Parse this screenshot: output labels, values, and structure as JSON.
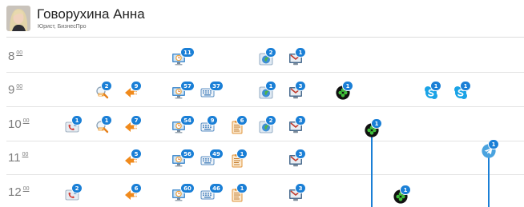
{
  "user": {
    "name": "Говорухина Анна",
    "role": "Юрист, БизнесПро"
  },
  "hours": [
    {
      "hour": "8",
      "minutes": "00"
    },
    {
      "hour": "9",
      "minutes": "00"
    },
    {
      "hour": "10",
      "minutes": "00"
    },
    {
      "hour": "11",
      "minutes": "00"
    },
    {
      "hour": "12",
      "minutes": "00"
    }
  ],
  "rows": {
    "r8": {
      "monitor": "11",
      "globe": "2",
      "mail": "1"
    },
    "r9": {
      "search": "2",
      "arrow": "9",
      "monitor": "57",
      "keyboard": "37",
      "globe": "1",
      "mail": "3",
      "app": "1",
      "skype_a": "1",
      "skype_b": "1"
    },
    "r10": {
      "call": "1",
      "search": "1",
      "arrow": "7",
      "monitor": "54",
      "keyboard": "9",
      "document": "6",
      "globe": "2",
      "mail": "3",
      "app": "1"
    },
    "r11": {
      "arrow": "5",
      "monitor": "56",
      "keyboard": "49",
      "document": "1",
      "mail": "3",
      "telegram": "1"
    },
    "r12": {
      "call": "2",
      "arrow": "6",
      "monitor": "60",
      "keyboard": "46",
      "document": "1",
      "mail": "3",
      "app": "1"
    }
  },
  "icons": {
    "monitor": "monitor-clock-icon",
    "keyboard": "keyboard-icon",
    "globe": "globe-icon",
    "mail": "mail-icon",
    "search": "search-icon",
    "arrow": "arrow-left-icon",
    "document": "document-icon",
    "call": "call-icon",
    "app": "clover-app-icon",
    "skype": "skype-icon",
    "telegram": "telegram-icon"
  },
  "colors": {
    "badge": "#1a7fd6",
    "arrow": "#f08a1c",
    "skype": "#1aa3e6",
    "telegram": "#4aa3df"
  }
}
